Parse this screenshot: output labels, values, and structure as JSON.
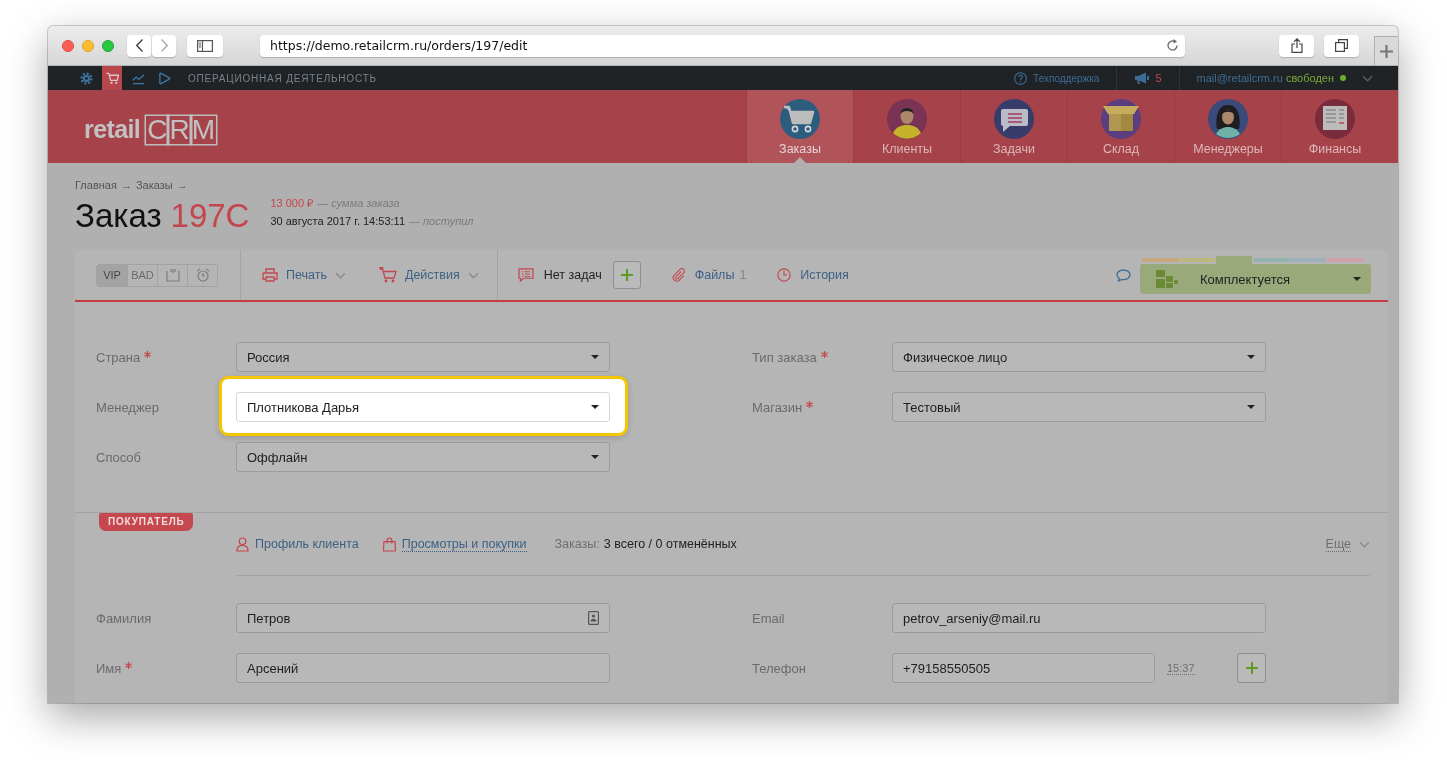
{
  "browser": {
    "url": "https://demo.retailcrm.ru/orders/197/edit"
  },
  "top_bar": {
    "modules": [
      {
        "kind": "settings",
        "selected": false
      },
      {
        "kind": "orders",
        "selected": true
      },
      {
        "kind": "analytics",
        "selected": false
      },
      {
        "kind": "play",
        "selected": false
      }
    ],
    "section": "ОПЕРАЦИОННАЯ ДЕЯТЕЛЬНОСТЬ",
    "support": "Техподдержка",
    "notifications": "5",
    "email": "mail@retailcrm.ru",
    "status": "свободен"
  },
  "header": {
    "logo": {
      "text": "retail",
      "boxed": "CRM"
    },
    "nav": [
      {
        "kind": "orders",
        "label": "Заказы",
        "selected": true
      },
      {
        "kind": "clients",
        "label": "Клиенты",
        "selected": false
      },
      {
        "kind": "tasks",
        "label": "Задачи",
        "selected": false
      },
      {
        "kind": "warehouse",
        "label": "Склад",
        "selected": false
      },
      {
        "kind": "managers",
        "label": "Менеджеры",
        "selected": false
      },
      {
        "kind": "finance",
        "label": "Финансы",
        "selected": false
      }
    ]
  },
  "order": {
    "breadcrumbs": [
      {
        "label": "Главная",
        "separator": "→"
      },
      {
        "label": "Заказы",
        "separator": "→"
      }
    ],
    "title": "Заказ",
    "number": "197C",
    "amount": "13 000 ₽",
    "amount_caption": "— сумма заказа",
    "date": "30 августа 2017 г. 14:53:11",
    "date_caption": "— поступил"
  },
  "toolbar": {
    "flags": [
      {
        "kind": "text",
        "label": "VIP",
        "selected": true
      },
      {
        "kind": "text",
        "label": "BAD",
        "selected": false
      },
      {
        "kind": "box",
        "selected": false
      },
      {
        "kind": "alarm",
        "selected": false
      }
    ],
    "actions": [
      {
        "kind": "print",
        "label": "Печать"
      },
      {
        "kind": "cart",
        "label": "Действия"
      }
    ],
    "tasks": "Нет задач",
    "files": {
      "label": "Файлы",
      "count": "1"
    },
    "history": "История",
    "status": {
      "label": "Комплектуется",
      "groups": [
        {
          "color": "#c8a77f",
          "selected": false
        },
        {
          "color": "#bdb77b",
          "selected": false
        },
        {
          "color": "#9aa97a",
          "selected": true
        },
        {
          "color": "#93b3af",
          "selected": false
        },
        {
          "color": "#9db1bd",
          "selected": false
        },
        {
          "color": "#d0a1a8",
          "selected": false
        }
      ]
    }
  },
  "order_form": [
    {
      "label": "Страна",
      "required": true,
      "value": "Россия",
      "highlighted": false
    },
    {
      "label": "Тип заказа",
      "required": true,
      "value": "Физическое лицо",
      "highlighted": false
    },
    {
      "label": "Менеджер",
      "required": false,
      "value": "Плотникова Дарья",
      "highlighted": true
    },
    {
      "label": "Магазин",
      "required": true,
      "value": "Тестовый",
      "highlighted": false
    },
    {
      "label": "Способ",
      "required": false,
      "value": "Оффлайн",
      "highlighted": false
    }
  ],
  "customer": {
    "badge": "ПОКУПАТЕЛЬ",
    "links": [
      {
        "kind": "profile",
        "label": "Профиль клиента"
      },
      {
        "kind": "views",
        "label": "Просмотры и покупки"
      }
    ],
    "orders_label": "Заказы:",
    "orders_value": "3 всего / 0 отменённых",
    "more": "Еще",
    "fields": [
      {
        "kind": "contact",
        "label": "Фамилия",
        "required": false,
        "value": "Петров"
      },
      {
        "kind": "text",
        "label": "Email",
        "required": false,
        "value": "petrov_arseniy@mail.ru"
      },
      {
        "kind": "text",
        "label": "Имя",
        "required": true,
        "value": "Арсений"
      },
      {
        "kind": "phone",
        "label": "Телефон",
        "required": false,
        "value": "+79158550505",
        "time": "15:37"
      }
    ]
  }
}
